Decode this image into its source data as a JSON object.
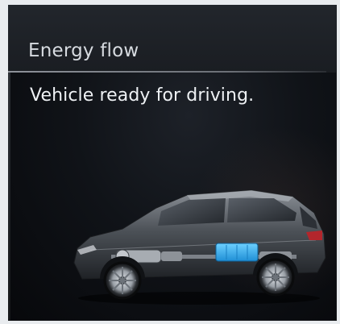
{
  "screen": {
    "title": "Energy flow",
    "status": "Vehicle ready for driving."
  },
  "vehicle": {
    "icon": "car-drivetrain-icon",
    "battery_color": "#2fa8e8"
  },
  "colors": {
    "title_text": "#d7dbe0",
    "status_text": "#eef1f4",
    "background": "#101318"
  }
}
